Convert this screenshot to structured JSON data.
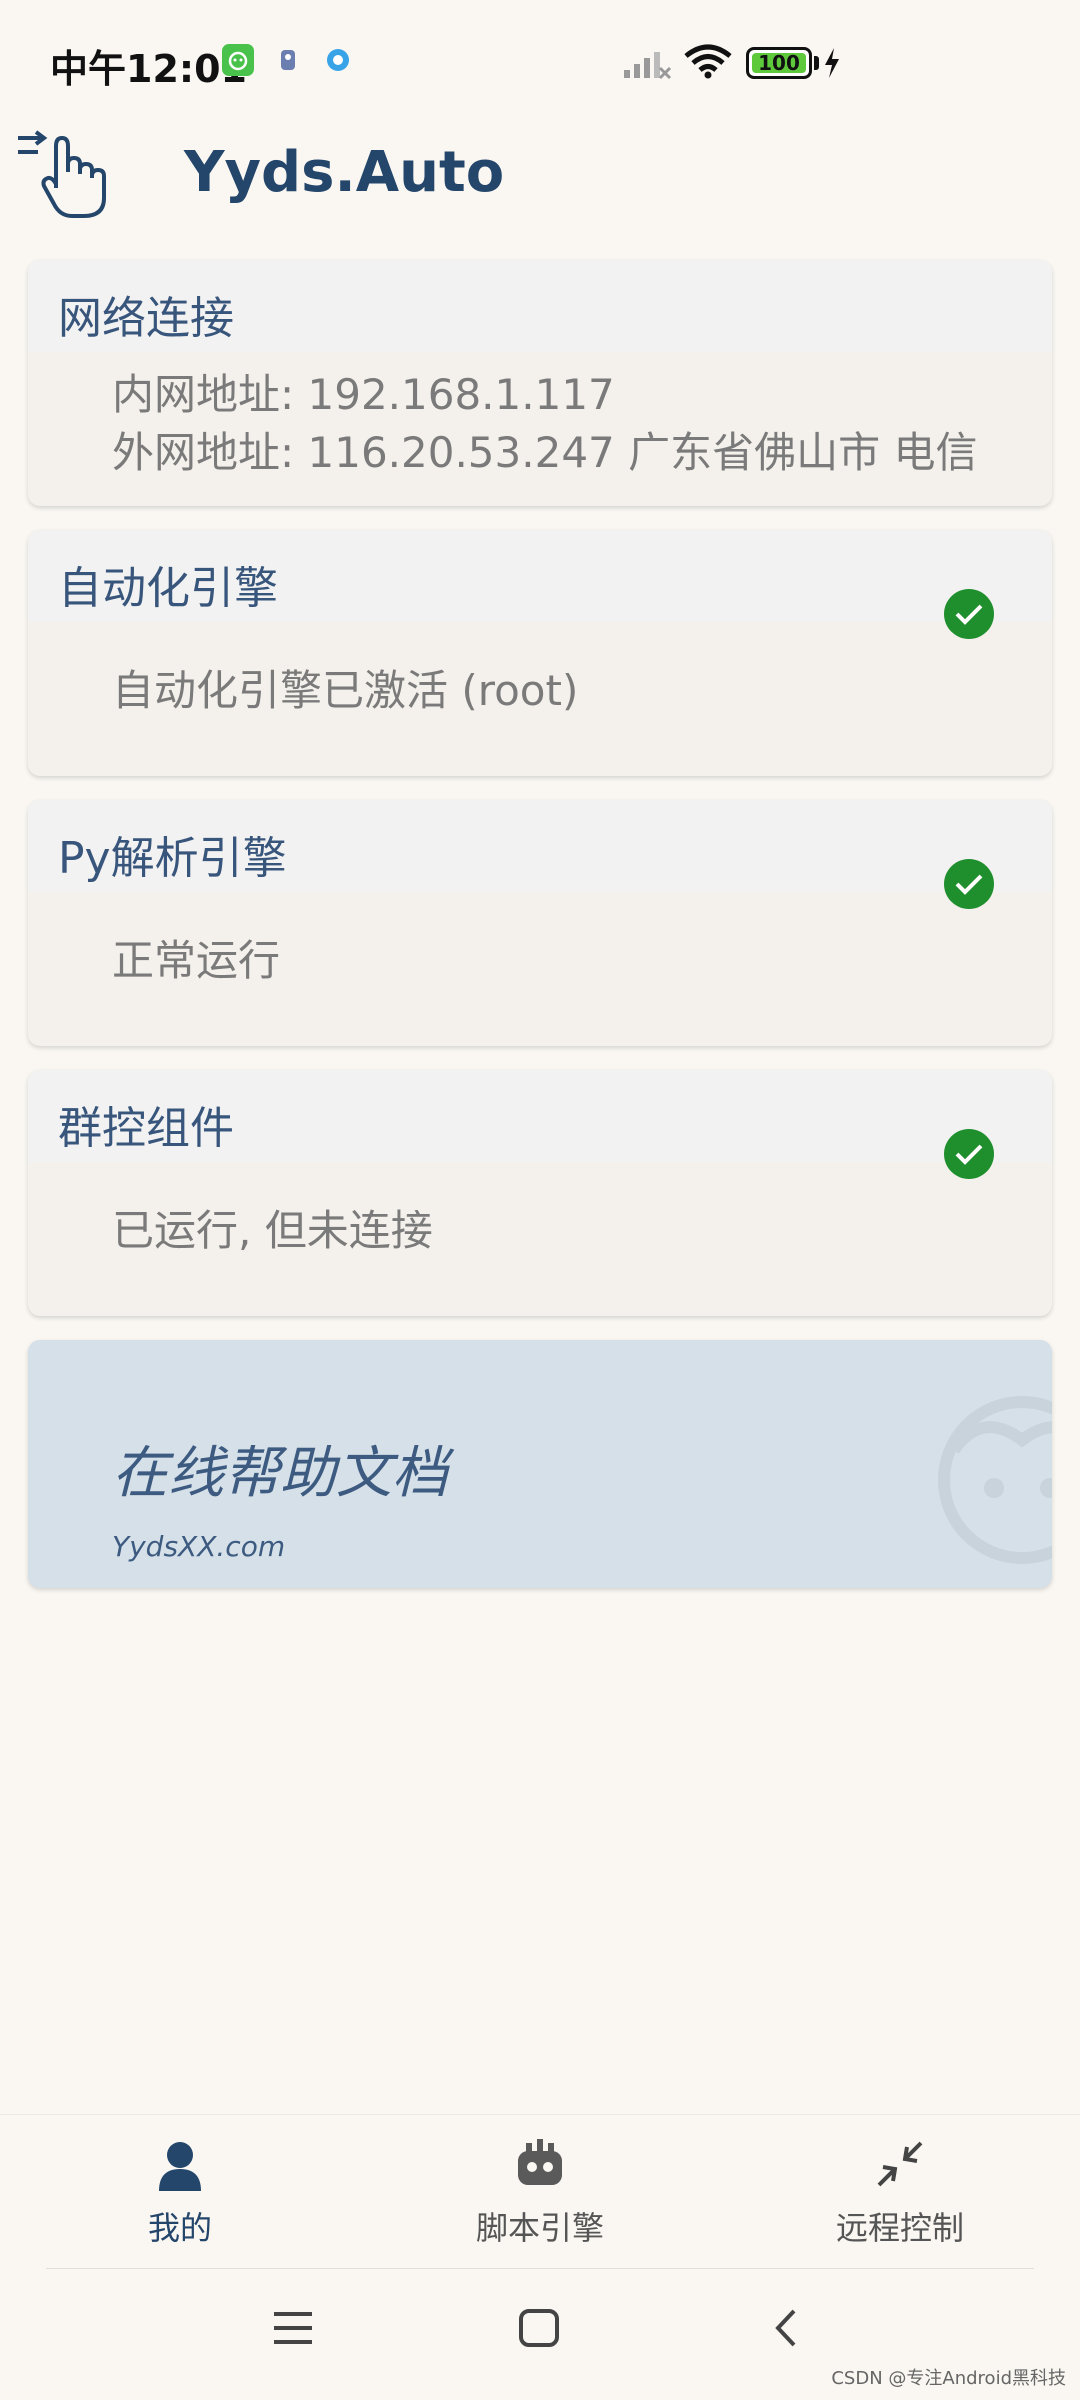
{
  "status_bar": {
    "time": "中午12:01",
    "battery": "100",
    "icons": [
      "app-notification-icon",
      "robot-notification-icon",
      "browser-notification-icon",
      "signal-icon",
      "wifi-icon",
      "battery-icon",
      "charging-icon"
    ]
  },
  "app": {
    "title": "Yyds.Auto",
    "logo": "hand-pointer-icon"
  },
  "cards": {
    "network": {
      "title": "网络连接",
      "lines": [
        "内网地址: 192.168.1.117",
        "外网地址: 116.20.53.247 广东省佛山市 电信"
      ]
    },
    "automation": {
      "title": "自动化引擎",
      "status": "自动化引擎已激活 (root)",
      "icon": "check-circle-icon"
    },
    "python": {
      "title": "Py解析引擎",
      "status": "正常运行",
      "icon": "check-circle-icon"
    },
    "group_control": {
      "title": "群控组件",
      "status": "已运行, 但未连接",
      "icon": "check-circle-icon"
    }
  },
  "help": {
    "title": "在线帮助文档",
    "subtitle": "YydsXX.com",
    "icon": "face-icon"
  },
  "bottom_nav": {
    "items": [
      {
        "label": "我的",
        "icon": "person-icon",
        "active": true
      },
      {
        "label": "脚本引擎",
        "icon": "robot-icon",
        "active": false
      },
      {
        "label": "远程控制",
        "icon": "remote-arrows-icon",
        "active": false
      }
    ]
  },
  "system_nav": [
    "menu-icon",
    "home-icon",
    "back-icon"
  ],
  "watermark": "CSDN @专注Android黑科技",
  "colors": {
    "background": "#faf7f2",
    "primary": "#24466b",
    "success": "#1f8f2e",
    "help_bg": "#d5e0e8"
  }
}
